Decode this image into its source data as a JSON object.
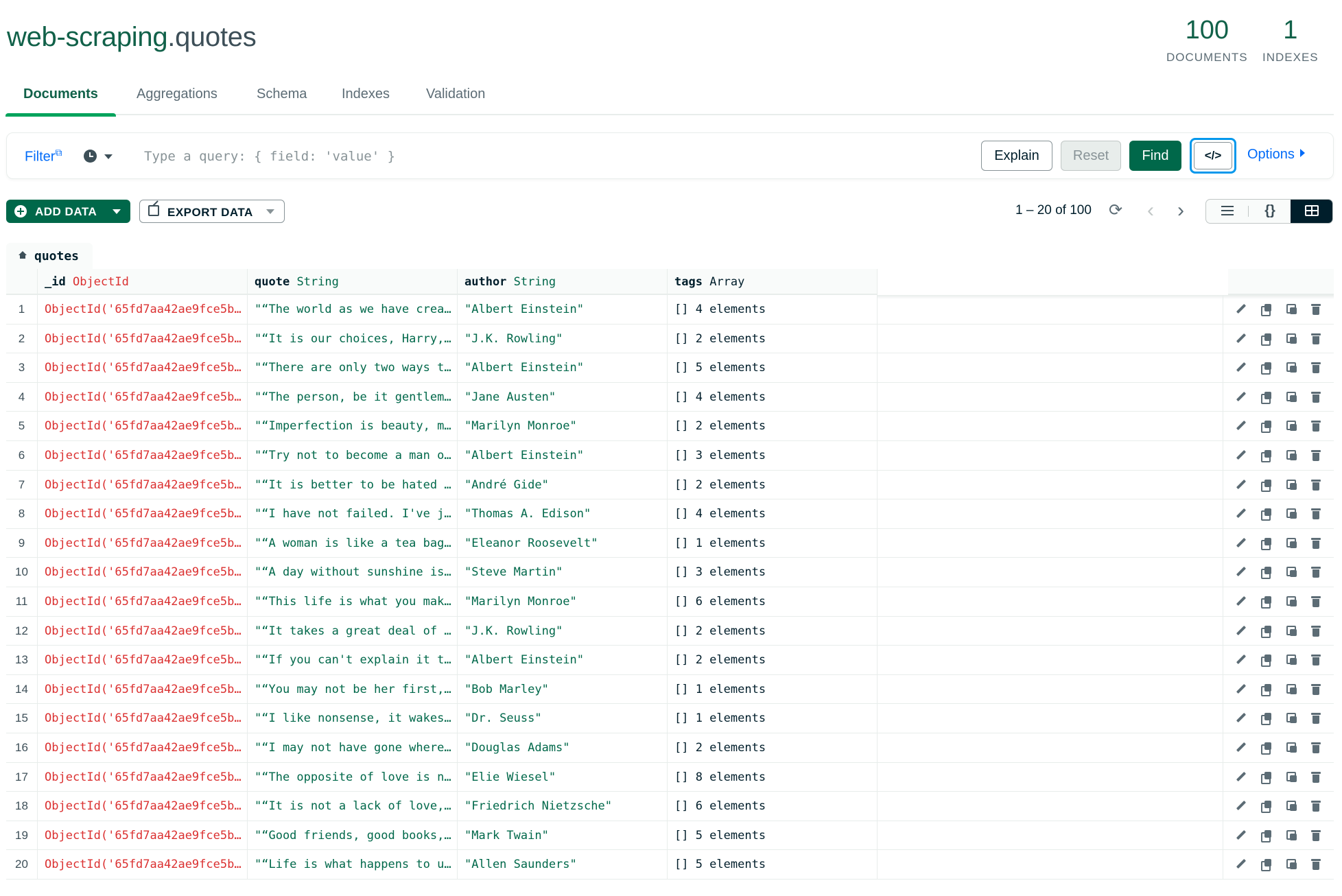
{
  "namespace": {
    "db": "web-scraping",
    "dot": ".",
    "collection": "quotes"
  },
  "stats": [
    {
      "value": "100",
      "label": "DOCUMENTS"
    },
    {
      "value": "1",
      "label": "INDEXES"
    }
  ],
  "tabs": [
    {
      "label": "Documents",
      "active": true
    },
    {
      "label": "Aggregations",
      "active": false
    },
    {
      "label": "Schema",
      "active": false
    },
    {
      "label": "Indexes",
      "active": false
    },
    {
      "label": "Validation",
      "active": false
    }
  ],
  "query_bar": {
    "filter_label": "Filter",
    "placeholder": "Type a query: { field: 'value' }",
    "explain_label": "Explain",
    "reset_label": "Reset",
    "find_label": "Find",
    "code_label": "</>",
    "options_label": "Options"
  },
  "toolbar": {
    "add_data_label": "ADD DATA",
    "export_data_label": "EXPORT DATA",
    "pagination": "1 – 20 of 100"
  },
  "breadcrumb": {
    "label": "quotes"
  },
  "columns": [
    {
      "name": "_id",
      "type": "ObjectId"
    },
    {
      "name": "quote",
      "type": "String"
    },
    {
      "name": "author",
      "type": "String"
    },
    {
      "name": "tags",
      "type": "Array"
    }
  ],
  "rows": [
    {
      "n": "1",
      "id": "ObjectId('65fd7aa42ae9fce5b…",
      "quote": "\"“The world as we have crea…",
      "author": "\"Albert Einstein\"",
      "tags": "[] 4 elements"
    },
    {
      "n": "2",
      "id": "ObjectId('65fd7aa42ae9fce5b…",
      "quote": "\"“It is our choices, Harry,…",
      "author": "\"J.K. Rowling\"",
      "tags": "[] 2 elements"
    },
    {
      "n": "3",
      "id": "ObjectId('65fd7aa42ae9fce5b…",
      "quote": "\"“There are only two ways t…",
      "author": "\"Albert Einstein\"",
      "tags": "[] 5 elements"
    },
    {
      "n": "4",
      "id": "ObjectId('65fd7aa42ae9fce5b…",
      "quote": "\"“The person, be it gentlem…",
      "author": "\"Jane Austen\"",
      "tags": "[] 4 elements"
    },
    {
      "n": "5",
      "id": "ObjectId('65fd7aa42ae9fce5b…",
      "quote": "\"“Imperfection is beauty, m…",
      "author": "\"Marilyn Monroe\"",
      "tags": "[] 2 elements"
    },
    {
      "n": "6",
      "id": "ObjectId('65fd7aa42ae9fce5b…",
      "quote": "\"“Try not to become a man o…",
      "author": "\"Albert Einstein\"",
      "tags": "[] 3 elements"
    },
    {
      "n": "7",
      "id": "ObjectId('65fd7aa42ae9fce5b…",
      "quote": "\"“It is better to be hated …",
      "author": "\"André Gide\"",
      "tags": "[] 2 elements"
    },
    {
      "n": "8",
      "id": "ObjectId('65fd7aa42ae9fce5b…",
      "quote": "\"“I have not failed. I've j…",
      "author": "\"Thomas A. Edison\"",
      "tags": "[] 4 elements"
    },
    {
      "n": "9",
      "id": "ObjectId('65fd7aa42ae9fce5b…",
      "quote": "\"“A woman is like a tea bag…",
      "author": "\"Eleanor Roosevelt\"",
      "tags": "[] 1 elements"
    },
    {
      "n": "10",
      "id": "ObjectId('65fd7aa42ae9fce5b…",
      "quote": "\"“A day without sunshine is…",
      "author": "\"Steve Martin\"",
      "tags": "[] 3 elements"
    },
    {
      "n": "11",
      "id": "ObjectId('65fd7aa42ae9fce5b…",
      "quote": "\"“This life is what you mak…",
      "author": "\"Marilyn Monroe\"",
      "tags": "[] 6 elements"
    },
    {
      "n": "12",
      "id": "ObjectId('65fd7aa42ae9fce5b…",
      "quote": "\"“It takes a great deal of …",
      "author": "\"J.K. Rowling\"",
      "tags": "[] 2 elements"
    },
    {
      "n": "13",
      "id": "ObjectId('65fd7aa42ae9fce5b…",
      "quote": "\"“If you can't explain it t…",
      "author": "\"Albert Einstein\"",
      "tags": "[] 2 elements"
    },
    {
      "n": "14",
      "id": "ObjectId('65fd7aa42ae9fce5b…",
      "quote": "\"“You may not be her first,…",
      "author": "\"Bob Marley\"",
      "tags": "[] 1 elements"
    },
    {
      "n": "15",
      "id": "ObjectId('65fd7aa42ae9fce5b…",
      "quote": "\"“I like nonsense, it wakes…",
      "author": "\"Dr. Seuss\"",
      "tags": "[] 1 elements"
    },
    {
      "n": "16",
      "id": "ObjectId('65fd7aa42ae9fce5b…",
      "quote": "\"“I may not have gone where…",
      "author": "\"Douglas Adams\"",
      "tags": "[] 2 elements"
    },
    {
      "n": "17",
      "id": "ObjectId('65fd7aa42ae9fce5b…",
      "quote": "\"“The opposite of love is n…",
      "author": "\"Elie Wiesel\"",
      "tags": "[] 8 elements"
    },
    {
      "n": "18",
      "id": "ObjectId('65fd7aa42ae9fce5b…",
      "quote": "\"“It is not a lack of love,…",
      "author": "\"Friedrich Nietzsche\"",
      "tags": "[] 6 elements"
    },
    {
      "n": "19",
      "id": "ObjectId('65fd7aa42ae9fce5b…",
      "quote": "\"“Good friends, good books,…",
      "author": "\"Mark Twain\"",
      "tags": "[] 5 elements"
    },
    {
      "n": "20",
      "id": "ObjectId('65fd7aa42ae9fce5b…",
      "quote": "\"“Life is what happens to u…",
      "author": "\"Allen Saunders\"",
      "tags": "[] 5 elements"
    }
  ],
  "colors": {
    "brand_green": "#00684a",
    "accent_green": "#00a35c",
    "link_blue": "#016bf8",
    "objectid_red": "#db3030",
    "string_green": "#00684a"
  },
  "icons": {
    "filter_external": "external-link-icon",
    "history": "clock-icon",
    "refresh": "refresh-icon",
    "prev": "chevron-left-icon",
    "next": "chevron-right-icon",
    "row_actions": [
      "edit-icon",
      "copy-icon",
      "clone-icon",
      "delete-icon"
    ]
  }
}
